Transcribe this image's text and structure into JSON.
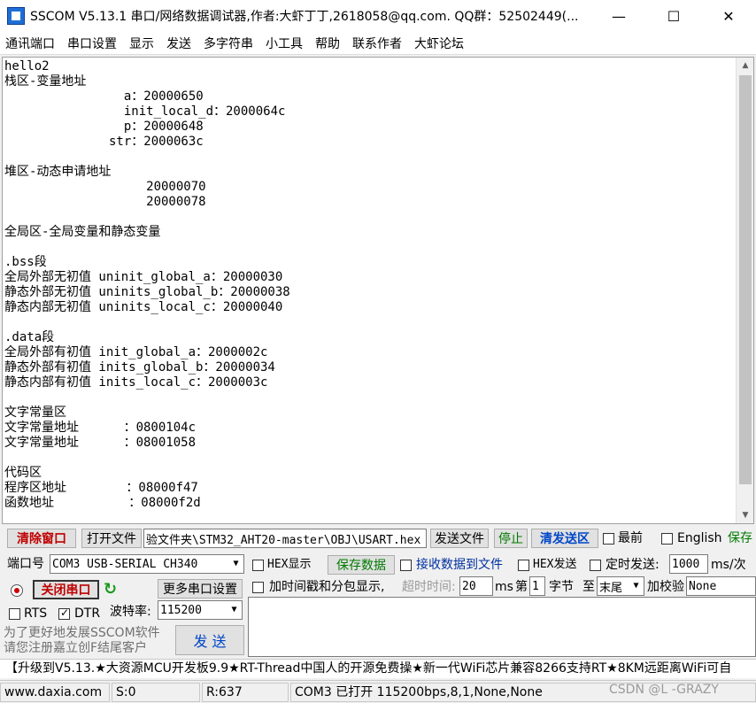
{
  "window": {
    "title": "SSCOM V5.13.1 串口/网络数据调试器,作者:大虾丁丁,2618058@qq.com. QQ群：52502449(...",
    "minimize_glyph": "—",
    "maximize_glyph": "☐",
    "close_glyph": "✕"
  },
  "menu": [
    "通讯端口",
    "串口设置",
    "显示",
    "发送",
    "多字符串",
    "小工具",
    "帮助",
    "联系作者",
    "大虾论坛"
  ],
  "terminal": {
    "text": "hello2\n栈区-变量地址\n                a：20000650\n                init_local_d：2000064c\n                p：20000648\n              str：2000063c\n\n堆区-动态申请地址\n                   20000070\n                   20000078\n\n全局区-全局变量和静态变量\n\n.bss段\n全局外部无初值 uninit_global_a：20000030\n静态外部无初值 uninits_global_b：20000038\n静态内部无初值 uninits_local_c：20000040\n\n.data段\n全局外部有初值 init_global_a：2000002c\n静态外部有初值 inits_global_b：20000034\n静态内部有初值 inits_local_c：2000003c\n\n文字常量区\n文字常量地址      ：0800104c\n文字常量地址      ：08001058\n\n代码区\n程序区地址        ：08000f47\n函数地址          ：08000f2d"
  },
  "toolbar1": {
    "clear_window": "清除窗口",
    "open_file": "打开文件",
    "file_path": "验文件夹\\STM32_AHT20-master\\OBJ\\USART.hex",
    "send_file": "发送文件",
    "stop": "停止",
    "clear_send": "清发送区",
    "last_label": "最前",
    "english_label": "English",
    "save_label": "保存"
  },
  "settings": {
    "port_label": "端口号",
    "port_value": "COM3 USB-SERIAL CH340",
    "hex_display": "HEX显示",
    "save_data": "保存数据",
    "recv_to_file": "接收数据到文件",
    "hex_send": "HEX发送",
    "timed_send": "定时发送:",
    "interval": "1000",
    "interval_unit": "ms/次",
    "close_port": "关闭串口",
    "more_settings": "更多串口设置",
    "timestamp_label": "加时间戳和分包显示,",
    "timeout_label": "超时时间:",
    "timeout_value": "20",
    "ms": "ms",
    "nth_label": "第",
    "nth_value": "1",
    "byte_label": "字节",
    "to_label": "至",
    "to_value": "末尾",
    "checksum_label": "加校验",
    "checksum_value": "None",
    "rts": "RTS",
    "dtr": "DTR",
    "baud_label": "波特率:",
    "baud_value": "115200",
    "promo_line1": "为了更好地发展SSCOM软件",
    "promo_line2": "请您注册嘉立创F结尾客户",
    "send": "发 送"
  },
  "ticker": "【升级到V5.13.★大资源MCU开发板9.9★RT-Thread中国人的开源免费操★新一代WiFi芯片兼容8266支持RT★8KM远距离WiFi可自",
  "status": {
    "site": "www.daxia.com",
    "sent": "S:0",
    "received": "R:637",
    "port_state": "COM3 已打开  115200bps,8,1,None,None",
    "watermark": "CSDN @L -GRAZY"
  }
}
